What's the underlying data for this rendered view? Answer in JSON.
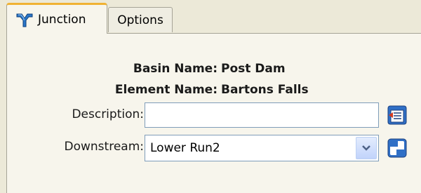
{
  "tabs": [
    {
      "label": "Junction",
      "icon": "junction-icon",
      "active": true
    },
    {
      "label": "Options",
      "active": false
    }
  ],
  "form": {
    "basin_label": "Basin Name:",
    "basin_value": "Post Dam",
    "element_label": "Element Name:",
    "element_value": "Bartons Falls",
    "description_label": "Description:",
    "description_value": "",
    "downstream_label": "Downstream:",
    "downstream_value": "Lower Run2"
  },
  "icons": {
    "description_button": "edit-description-icon",
    "downstream_button": "downstream-selector-icon",
    "dropdown": "chevron-down-icon"
  },
  "colors": {
    "active_tab_accent": "#f0b233",
    "panel_background": "#f7f5ec",
    "window_background": "#ece9d8"
  }
}
